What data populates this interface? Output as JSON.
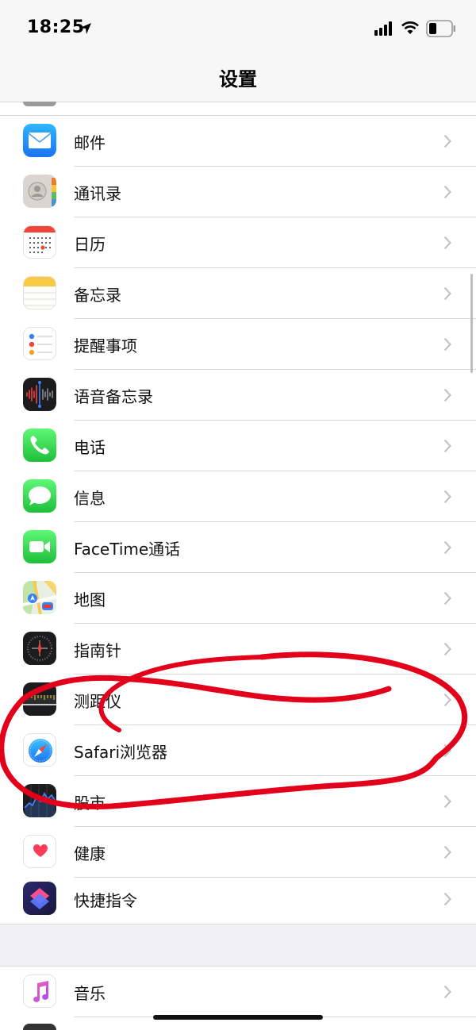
{
  "status_bar": {
    "time": "18:25",
    "icons": [
      "location-arrow-icon",
      "cellular-signal-icon",
      "wifi-icon",
      "battery-icon"
    ]
  },
  "nav": {
    "title": "设置"
  },
  "rows": [
    {
      "label": "邮件",
      "icon": "mail-icon"
    },
    {
      "label": "通讯录",
      "icon": "contacts-icon"
    },
    {
      "label": "日历",
      "icon": "calendar-icon"
    },
    {
      "label": "备忘录",
      "icon": "notes-icon"
    },
    {
      "label": "提醒事项",
      "icon": "reminders-icon"
    },
    {
      "label": "语音备忘录",
      "icon": "voice-memos-icon"
    },
    {
      "label": "电话",
      "icon": "phone-icon"
    },
    {
      "label": "信息",
      "icon": "messages-icon"
    },
    {
      "label": "FaceTime通话",
      "icon": "facetime-icon"
    },
    {
      "label": "地图",
      "icon": "maps-icon"
    },
    {
      "label": "指南针",
      "icon": "compass-icon"
    },
    {
      "label": "测距仪",
      "icon": "measure-icon"
    },
    {
      "label": "Safari浏览器",
      "icon": "safari-icon"
    },
    {
      "label": "股市",
      "icon": "stocks-icon"
    },
    {
      "label": "健康",
      "icon": "health-icon"
    },
    {
      "label": "快捷指令",
      "icon": "shortcuts-icon"
    },
    {
      "label": "音乐",
      "icon": "music-icon"
    }
  ],
  "colors": {
    "annotation_red": "#e3001b",
    "separator": "#dcdcdc",
    "chevron": "#c4c4c7"
  }
}
